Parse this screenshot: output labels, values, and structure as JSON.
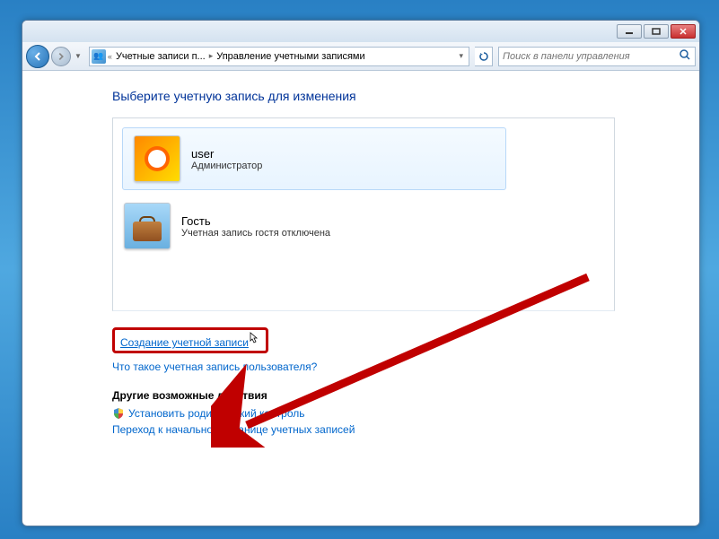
{
  "breadcrumb": {
    "seg1": "Учетные записи п...",
    "seg2": "Управление учетными записями"
  },
  "search": {
    "placeholder": "Поиск в панели управления"
  },
  "heading": "Выберите учетную запись для изменения",
  "accounts": [
    {
      "name": "user",
      "role": "Администратор"
    },
    {
      "name": "Гость",
      "role": "Учетная запись гостя отключена"
    }
  ],
  "links": {
    "create": "Создание учетной записи",
    "whatis": "Что такое учетная запись пользователя?",
    "other_heading": "Другие возможные действия",
    "parental": "Установить родительский контроль",
    "gohome": "Переход к начальной странице учетных записей"
  }
}
